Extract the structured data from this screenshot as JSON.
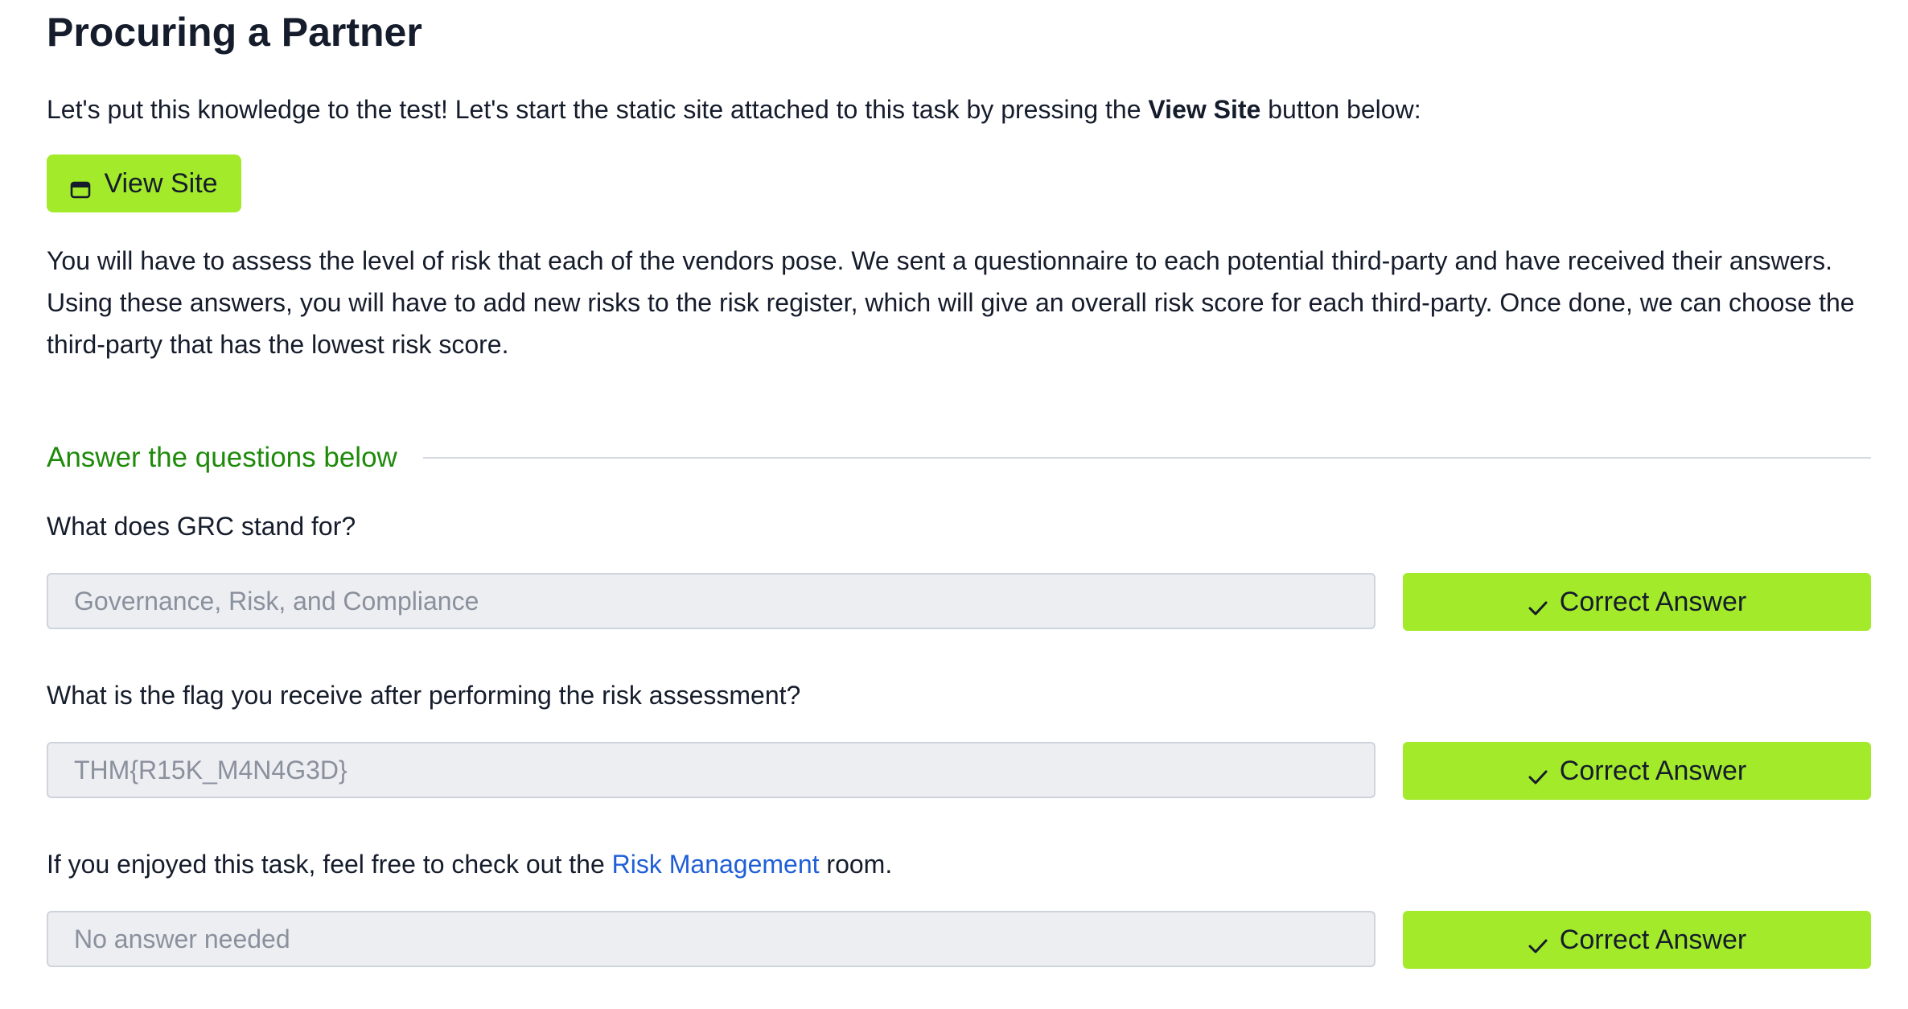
{
  "task": {
    "title": "Procuring a Partner",
    "intro_before": "Let's put this knowledge to the test! Let's start the static site attached to this task by pressing the ",
    "intro_bold": "View Site",
    "intro_after": " button below:",
    "view_site_label": "View Site",
    "view_site_icon": "browser-window-icon",
    "description": "You will have to assess the level of risk that each of the vendors pose. We sent a questionnaire to each potential third-party and have received their answers. Using these answers, you will have to add new risks to the risk register, which will give an overall risk score for each third-party. Once done, we can choose the third-party that has the lowest risk score."
  },
  "answers": {
    "header": "Answer the questions below",
    "questions": [
      {
        "text": "What does GRC stand for?",
        "answer": "Governance, Risk, and Compliance",
        "button_label": "Correct Answer"
      },
      {
        "text": "What is the flag you receive after performing the risk assessment?",
        "answer": "THM{R15K_M4N4G3D}",
        "button_label": "Correct Answer"
      },
      {
        "text_before": "If you enjoyed this task, feel free to check out the ",
        "link_text": "Risk Management",
        "text_after": " room.",
        "answer": "No answer needed",
        "button_label": "Correct Answer"
      }
    ]
  },
  "colors": {
    "accent_green": "#a3ea2a",
    "header_green": "#1e8a0a",
    "link_blue": "#1f5fd6",
    "text_dark": "#151c2b",
    "input_bg": "#eceef2"
  }
}
